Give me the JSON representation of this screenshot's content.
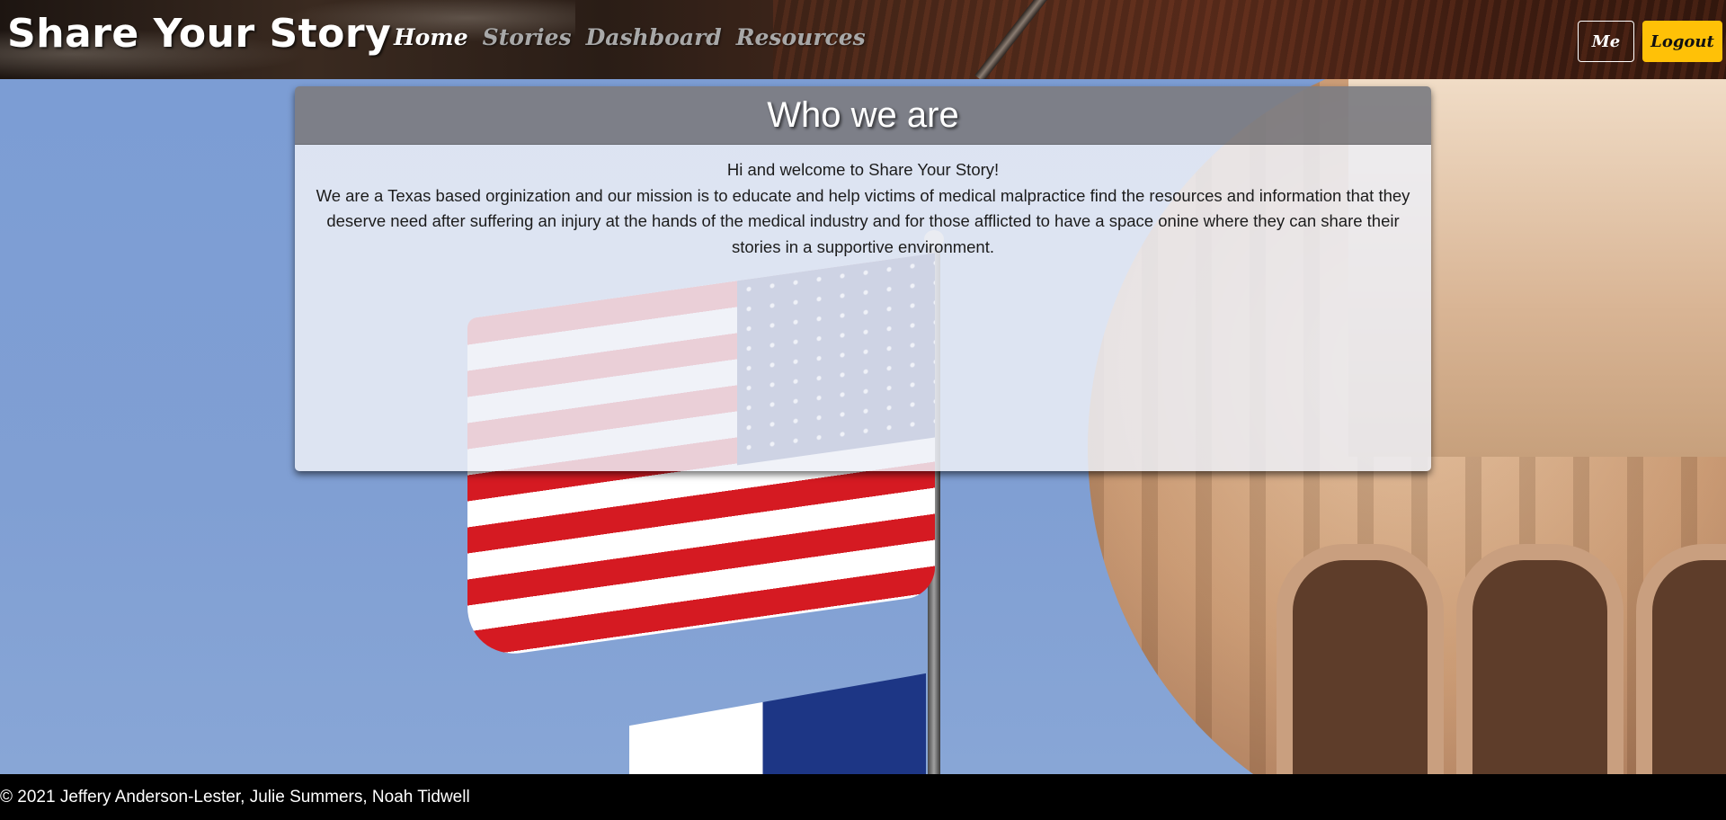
{
  "header": {
    "brand": "Share Your Story",
    "nav": [
      {
        "label": "Home",
        "active": true
      },
      {
        "label": "Stories",
        "active": false
      },
      {
        "label": "Dashboard",
        "active": false
      },
      {
        "label": "Resources",
        "active": false
      }
    ],
    "me_label": "Me",
    "logout_label": "Logout"
  },
  "card": {
    "title": "Who we are",
    "greeting": "Hi and welcome to Share Your Story!",
    "body": "We are a Texas based orginization and our mission is to educate and help victims of medical malpractice find the resources and information that they deserve need after suffering an injury at the hands of the medical industry and for those afflicted to have a space onine where they can share their stories in a supportive environment."
  },
  "footer": {
    "copyright": "© 2021 Jeffery Anderson-Lester, Julie Summers, Noah Tidwell"
  },
  "colors": {
    "logout_button": "#ffc107",
    "footer_bg": "#000000",
    "card_header_bg": "#7d7d82"
  }
}
